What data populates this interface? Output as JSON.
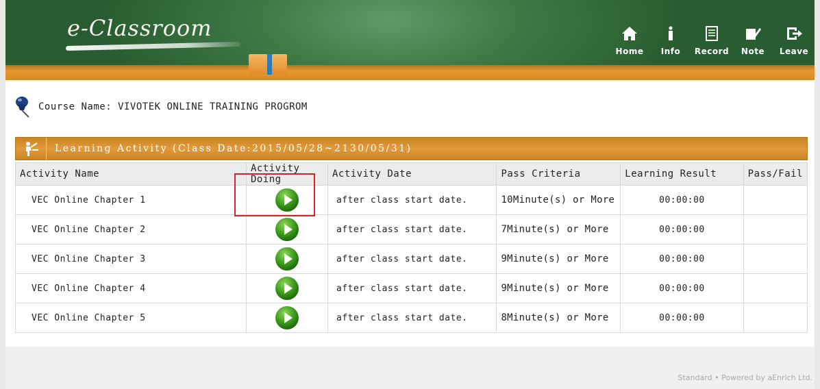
{
  "header": {
    "logo": "e-Classroom",
    "nav": [
      {
        "label": "Home",
        "icon": "home-icon"
      },
      {
        "label": "Info",
        "icon": "info-icon"
      },
      {
        "label": "Record",
        "icon": "record-icon"
      },
      {
        "label": "Note",
        "icon": "note-icon"
      },
      {
        "label": "Leave",
        "icon": "leave-icon"
      }
    ]
  },
  "course": {
    "label": "Course Name: VIVOTEK ONLINE TRAINING PROGROM"
  },
  "panel": {
    "title": "Learning Activity (Class Date:2015/05/28~2130/05/31)"
  },
  "table": {
    "headers": [
      "Activity Name",
      "Activity Doing",
      "Activity Date",
      "Pass Criteria",
      "Learning Result",
      "Pass/Fail"
    ],
    "rows": [
      {
        "name": "VEC Online Chapter 1",
        "date": "after class start date.",
        "criteria": "10Minute(s) or More",
        "result": "00:00:00",
        "pass": ""
      },
      {
        "name": "VEC Online Chapter 2",
        "date": "after class start date.",
        "criteria": "7Minute(s) or More",
        "result": "00:00:00",
        "pass": ""
      },
      {
        "name": "VEC Online Chapter 3",
        "date": "after class start date.",
        "criteria": "9Minute(s) or More",
        "result": "00:00:00",
        "pass": ""
      },
      {
        "name": "VEC Online Chapter 4",
        "date": "after class start date.",
        "criteria": "9Minute(s) or More",
        "result": "00:00:00",
        "pass": ""
      },
      {
        "name": "VEC Online Chapter 5",
        "date": "after class start date.",
        "criteria": "8Minute(s) or More",
        "result": "00:00:00",
        "pass": ""
      }
    ]
  },
  "footer": {
    "text": "Standard • Powered by aEnrich Ltd."
  },
  "colors": {
    "board_green": "#3f7a45",
    "shelf_orange": "#e29a3b",
    "highlight_red": "#e02020",
    "play_green": "#3c9a1c"
  }
}
